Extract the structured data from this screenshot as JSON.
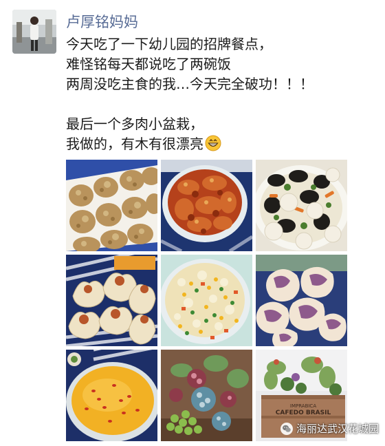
{
  "post": {
    "author": "卢厚铭妈妈",
    "lines": [
      "今天吃了一下幼儿园的招牌餐点，",
      "难怪铭每天都说吃了两碗饭",
      "两周没吃主食的我…今天完全破功！！！",
      "最后一个多肉小盆栽，",
      "我做的，有木有很漂亮"
    ],
    "emoji_icon": "grinning-face-icon"
  },
  "photos": [
    {
      "name": "photo-oat-cookies",
      "crate_text": ""
    },
    {
      "name": "photo-braised-chicken",
      "crate_text": ""
    },
    {
      "name": "photo-fishballs-mushroom",
      "crate_text": ""
    },
    {
      "name": "photo-shumai",
      "crate_text": ""
    },
    {
      "name": "photo-fried-rice",
      "crate_text": ""
    },
    {
      "name": "photo-purple-buns",
      "crate_text": ""
    },
    {
      "name": "photo-millet-porridge",
      "crate_text": ""
    },
    {
      "name": "photo-succulent-pot",
      "crate_text": ""
    },
    {
      "name": "photo-succulent-crate",
      "crate_line1": "IMPRABICA",
      "crate_line2": "CAFEDO BRASIL"
    }
  ],
  "watermark": {
    "text": "海丽达武汉花城园",
    "icon": "wechat-icon"
  },
  "colors": {
    "author": "#576b95",
    "text": "#1b1b1b",
    "background": "#ffffff"
  }
}
